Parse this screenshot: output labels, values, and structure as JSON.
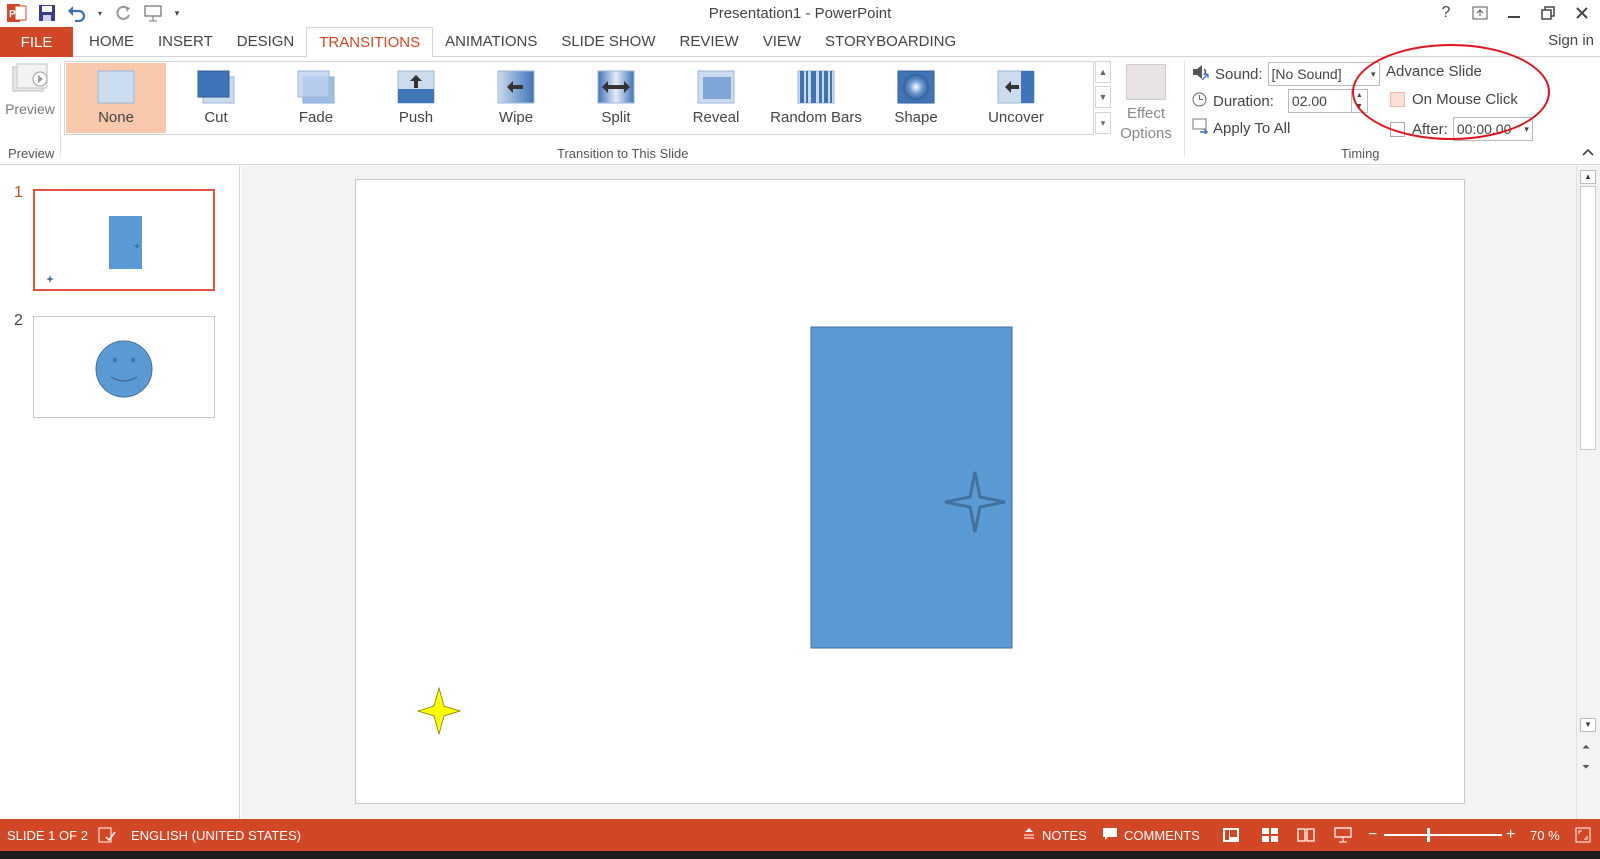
{
  "window": {
    "title": "Presentation1 - PowerPoint",
    "sign_in": "Sign in",
    "help": "?"
  },
  "tabs": {
    "file": "FILE",
    "items": [
      "HOME",
      "INSERT",
      "DESIGN",
      "TRANSITIONS",
      "ANIMATIONS",
      "SLIDE SHOW",
      "REVIEW",
      "VIEW",
      "STORYBOARDING"
    ],
    "active": "TRANSITIONS"
  },
  "ribbon": {
    "preview": {
      "button_label": "Preview",
      "group_label": "Preview"
    },
    "transitions": {
      "group_label": "Transition to This Slide",
      "items": [
        "None",
        "Cut",
        "Fade",
        "Push",
        "Wipe",
        "Split",
        "Reveal",
        "Random Bars",
        "Shape",
        "Uncover"
      ],
      "selected": "None",
      "effect_options_line1": "Effect",
      "effect_options_line2": "Options"
    },
    "timing": {
      "group_label": "Timing",
      "sound_label": "Sound:",
      "sound_value": "[No Sound]",
      "duration_label": "Duration:",
      "duration_value": "02.00",
      "apply_all_label": "Apply To All",
      "advance_slide_label": "Advance Slide",
      "on_mouse_click_label": "On Mouse Click",
      "after_label": "After:",
      "after_value": "00:00.00"
    }
  },
  "slides": {
    "numbers": [
      "1",
      "2"
    ]
  },
  "statusbar": {
    "slide_info": "SLIDE 1 OF 2",
    "language": "ENGLISH (UNITED STATES)",
    "notes": "NOTES",
    "comments": "COMMENTS",
    "zoom": "70 %"
  },
  "colors": {
    "accent": "#d24726",
    "shape_blue": "#5b9bd5",
    "star_yellow": "#ffff00",
    "highlight_ellipse": "#e0141f"
  }
}
